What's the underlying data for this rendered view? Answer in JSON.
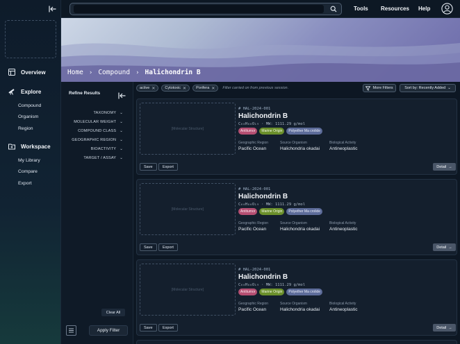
{
  "sidebar": {
    "sections": [
      {
        "label": "Overview",
        "icon": "layout-icon",
        "items": []
      },
      {
        "label": "Explore",
        "icon": "telescope-icon",
        "items": [
          "Compound",
          "Organism",
          "Region"
        ]
      },
      {
        "label": "Workspace",
        "icon": "folder-plus-icon",
        "items": [
          "My Library",
          "Compare",
          "Export"
        ]
      }
    ]
  },
  "topbar": {
    "search_placeholder": "",
    "links": [
      "Tools",
      "Resources",
      "Help"
    ]
  },
  "breadcrumb": {
    "items": [
      "Home",
      "Compound",
      "Halichondrin B"
    ],
    "separator": "›"
  },
  "filters": {
    "title": "Refine Results",
    "items": [
      "TAXONOMY",
      "MOLECULAR WEIGHT",
      "COMPOUND CLASS",
      "GEOGRAPHIC REGION",
      "BIOACTIVITY",
      "TARGET / ASSAY"
    ],
    "clear_label": "Clear All",
    "apply_label": "Apply Filter"
  },
  "results": {
    "chips": [
      "active",
      "Cytotoxic",
      "Porifera"
    ],
    "chip_note": "Filter carried on from previous session.",
    "more_filters_label": "More Filters",
    "sort_label": "Sort by: Recently Added",
    "cards": [
      {
        "structure_placeholder": "[Molecular Structure]",
        "id": "# HAL-2024-001",
        "name": "Halichondrin B",
        "formula": "C₆₀H₈₆O₁₉ · MW: 1111.29 g/mol",
        "tags": [
          "Antitumor",
          "Marine Origin",
          "Polyether Ma crolide"
        ],
        "props": [
          {
            "label": "Geographic Region",
            "value": "Pacific Ocean"
          },
          {
            "label": "Source Organism",
            "value": "Halichondria okadai"
          },
          {
            "label": "Biological Activity",
            "value": "Antineoplastic"
          }
        ],
        "save_label": "Save",
        "export_label": "Export",
        "detail_label": "Detail"
      },
      {
        "structure_placeholder": "[Molecular Structure]",
        "id": "# HAL-2024-001",
        "name": "Halichondrin B",
        "formula": "C₆₀H₈₆O₁₉ · MW: 1111.29 g/mol",
        "tags": [
          "Antitumor",
          "Marine Origin",
          "Polyether Ma crolide"
        ],
        "props": [
          {
            "label": "Geographic Region",
            "value": "Pacific Ocean"
          },
          {
            "label": "Source Organism",
            "value": "Halichondria okadai"
          },
          {
            "label": "Biological Activity",
            "value": "Antineoplastic"
          }
        ],
        "save_label": "Save",
        "export_label": "Export",
        "detail_label": "Detail"
      },
      {
        "structure_placeholder": "[Molecular Structure]",
        "id": "# HAL-2024-001",
        "name": "Halichondrin B",
        "formula": "C₆₀H₈₆O₁₉ · MW: 1111.29 g/mol",
        "tags": [
          "Antitumor",
          "Marine Origin",
          "Polyether Ma crolide"
        ],
        "props": [
          {
            "label": "Geographic Region",
            "value": "Pacific Ocean"
          },
          {
            "label": "Source Organism",
            "value": "Halichondria okadai"
          },
          {
            "label": "Biological Activity",
            "value": "Antineoplastic"
          }
        ],
        "save_label": "Save",
        "export_label": "Export",
        "detail_label": "Detail"
      }
    ]
  },
  "colors": {
    "tag_antitumor": "#b54f72",
    "tag_marine": "#6b8f2b",
    "tag_polyether": "#5d6c9a"
  }
}
